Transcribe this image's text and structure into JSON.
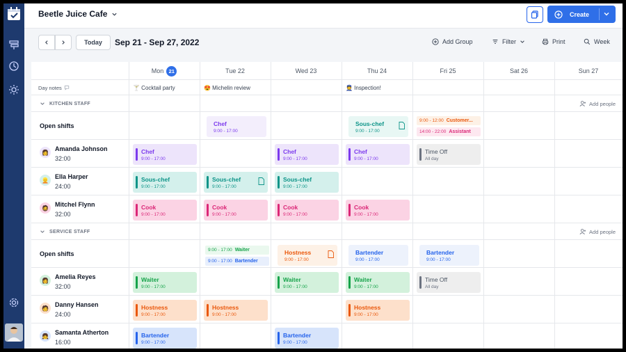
{
  "app": {
    "title": "Beetle Juice Cafe"
  },
  "header": {
    "create_label": "Create"
  },
  "toolbar": {
    "today_label": "Today",
    "date_range": "Sep 21 - Sep 27, 2022",
    "add_group_label": "Add Group",
    "filter_label": "Filter",
    "print_label": "Print",
    "view_label": "Week"
  },
  "days": [
    {
      "label": "Mon",
      "badge": "21"
    },
    {
      "label": "Tue 22"
    },
    {
      "label": "Wed 23"
    },
    {
      "label": "Thu 24"
    },
    {
      "label": "Fri 25"
    },
    {
      "label": "Sat 26"
    },
    {
      "label": "Sun 27"
    }
  ],
  "notes": {
    "label": "Day notes",
    "items": [
      "🍸 Cocktail party",
      "😍 Michelin review",
      "",
      "👮 Inspection!",
      "",
      "",
      ""
    ]
  },
  "sections": [
    {
      "title": "KITCHEN STAFF",
      "add_people": "Add people"
    },
    {
      "title": "SERVICE STAFF",
      "add_people": "Add people"
    }
  ],
  "rows": {
    "open_label": "Open shifts",
    "people": [
      {
        "name": "Amanda Johnson",
        "hours": "32:00",
        "avatar": "👩"
      },
      {
        "name": "Ella Harper",
        "hours": "24:00",
        "avatar": "👱"
      },
      {
        "name": "Mitchel Flynn",
        "hours": "32:00",
        "avatar": "🧔"
      },
      {
        "name": "Amelia Reyes",
        "hours": "32:00",
        "avatar": "👩"
      },
      {
        "name": "Danny Hansen",
        "hours": "24:00",
        "avatar": "🧑"
      },
      {
        "name": "Samanta Atherton",
        "hours": "16:00",
        "avatar": "👧"
      }
    ]
  },
  "shifts": {
    "chef": {
      "title": "Chef",
      "time": "9:00 - 17:00"
    },
    "souschef": {
      "title": "Sous-chef",
      "time": "9:00 - 17:00"
    },
    "cook": {
      "title": "Cook",
      "time": "9:00 - 17:00"
    },
    "timeoff": {
      "title": "Time Off",
      "time": "All day"
    },
    "waiter": {
      "title": "Waiter",
      "time": "9:00 - 17:00"
    },
    "hostness": {
      "title": "Hostness",
      "time": "9:00 - 17:00"
    },
    "bartender": {
      "title": "Bartender",
      "time": "9:00 - 17:00"
    },
    "fri_open1": {
      "time": "9:00 - 12:00",
      "title": "Customer..."
    },
    "fri_open2": {
      "time": "14:00 - 22:00",
      "title": "Assistant"
    },
    "tue_open1": {
      "time": "9:00 - 17:00",
      "title": "Waiter"
    },
    "tue_open2": {
      "time": "9:00 - 17:00",
      "title": "Bartender"
    }
  },
  "colors": {
    "chef": "#7c3aed",
    "chef_bg": "#ede4fb",
    "souschef": "#0d9488",
    "souschef_bg": "#d4f0ec",
    "cook": "#db2777",
    "cook_bg": "#fbd3e4",
    "timeoff": "#6b7280",
    "timeoff_bg": "#eeeeee",
    "waiter": "#16a34a",
    "waiter_bg": "#d3f1dc",
    "hostness": "#ea580c",
    "hostness_bg": "#fde0cb",
    "bartender": "#2563eb",
    "bartender_bg": "#d7e4fb",
    "accent": "#2f6fe8",
    "sidebar": "#1e3a6e"
  }
}
